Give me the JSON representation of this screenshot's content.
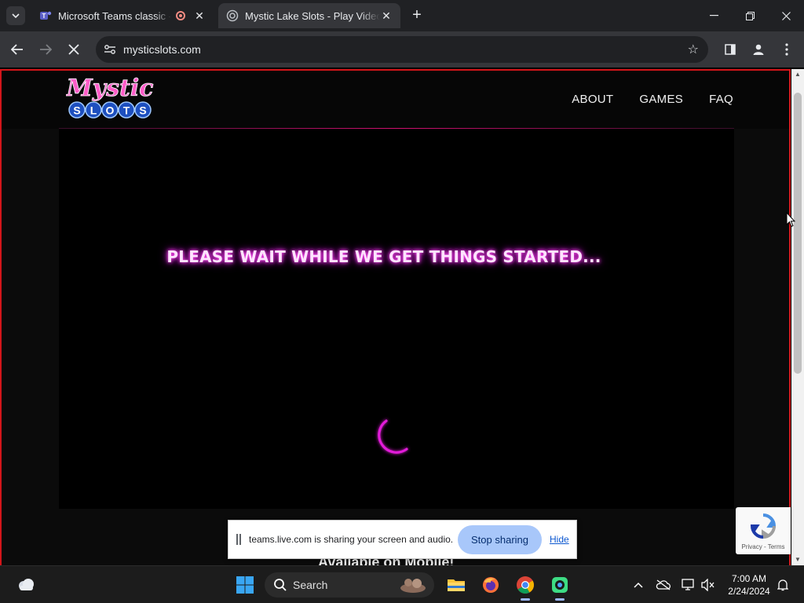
{
  "browser": {
    "tabs": [
      {
        "title": "Microsoft Teams classic - Io",
        "recording": true,
        "active": false
      },
      {
        "title": "Mystic Lake Slots - Play Video F",
        "recording": false,
        "active": true
      }
    ],
    "url": "mysticslots.com"
  },
  "site": {
    "logo_top": "Mystic",
    "logo_bottom": "SLOTS",
    "nav": [
      "ABOUT",
      "GAMES",
      "FAQ"
    ],
    "loading_message": "PLEASE WAIT WHILE WE GET THINGS STARTED...",
    "mobile_heading": "Available on Mobile!",
    "accent_color": "#e21bd9",
    "frame_color": "#d3151a"
  },
  "recaptcha": {
    "links": "Privacy - Terms"
  },
  "share_bar": {
    "message": "teams.live.com is sharing your screen and audio.",
    "stop_label": "Stop sharing",
    "hide_label": "Hide"
  },
  "taskbar": {
    "search_label": "Search",
    "time": "7:00 AM",
    "date": "2/24/2024"
  }
}
